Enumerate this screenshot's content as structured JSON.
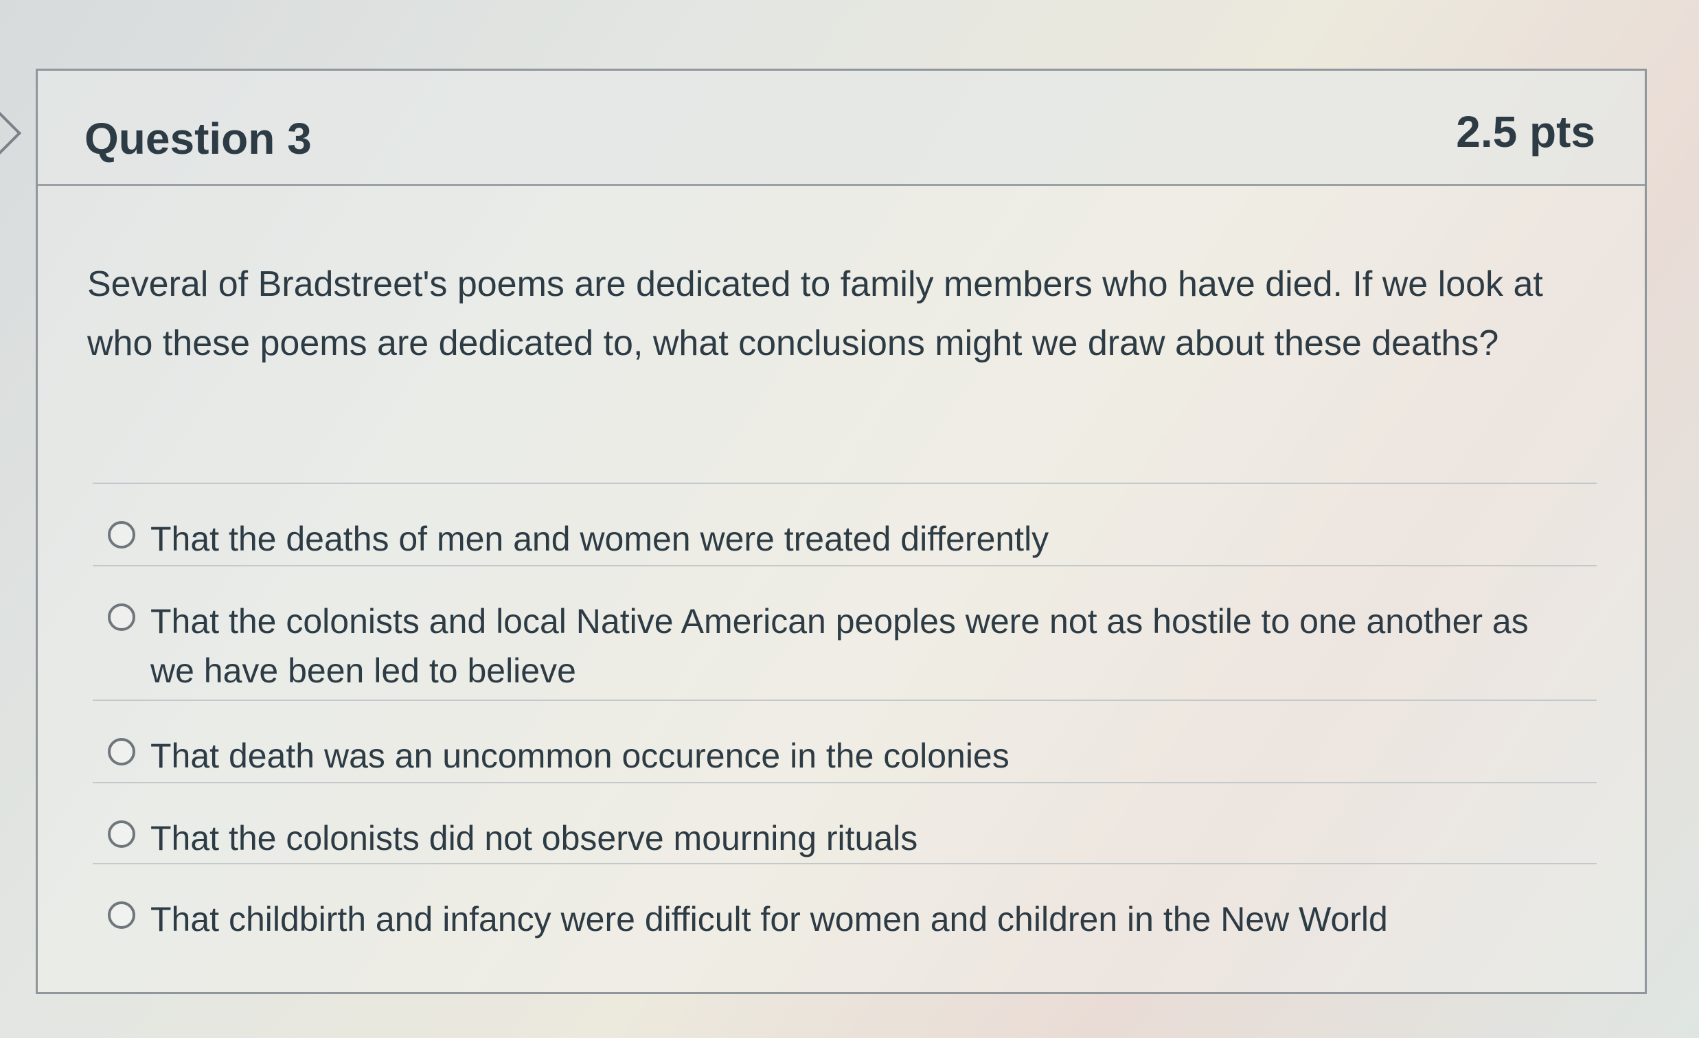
{
  "question": {
    "title": "Question 3",
    "points": "2.5 pts",
    "text": "Several of Bradstreet's poems are dedicated to family members who have died. If we look at who these poems are dedicated to, what conclusions might we draw about these deaths?",
    "answers": [
      {
        "label": "That the deaths of men and women were treated differently",
        "selected": false
      },
      {
        "label": "That the colonists and local Native American peoples were not as hostile to one another as we have been led to believe",
        "selected": false
      },
      {
        "label": "That death was an uncommon occurence in the colonies",
        "selected": false
      },
      {
        "label": "That the colonists did not observe mourning rituals",
        "selected": false
      },
      {
        "label": "That childbirth and infancy were difficult for women and children in the New World",
        "selected": false
      }
    ]
  },
  "icons": {
    "collapse": "chevron-right-icon",
    "radio": "radio-button-icon"
  },
  "colors": {
    "text": "#2d3b45",
    "border": "#8f979c"
  }
}
